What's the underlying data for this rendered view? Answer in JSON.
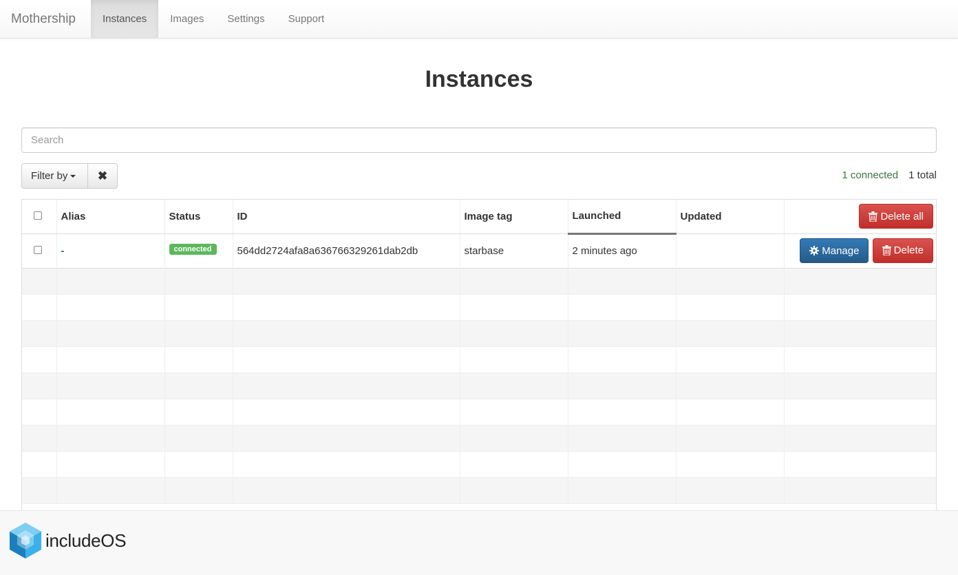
{
  "navbar": {
    "brand": "Mothership",
    "items": [
      {
        "label": "Instances",
        "active": true
      },
      {
        "label": "Images",
        "active": false
      },
      {
        "label": "Settings",
        "active": false
      },
      {
        "label": "Support",
        "active": false
      }
    ]
  },
  "page": {
    "title": "Instances"
  },
  "search": {
    "placeholder": "Search",
    "value": ""
  },
  "filter": {
    "label": "Filter by",
    "clear_icon": "✖"
  },
  "counts": {
    "connected": "1 connected",
    "total": "1 total"
  },
  "table": {
    "headers": {
      "alias": "Alias",
      "status": "Status",
      "id": "ID",
      "image_tag": "Image tag",
      "launched": "Launched",
      "updated": "Updated"
    },
    "sorted_column": "launched",
    "delete_all_label": "Delete all",
    "rows": [
      {
        "alias": "-",
        "status": "connected",
        "id": "564dd2724afa8a636766329261dab2db",
        "image_tag": "starbase",
        "launched": "2 minutes ago",
        "updated": "",
        "manage_label": "Manage",
        "delete_label": "Delete"
      }
    ]
  },
  "footer": {
    "logo_text_a": "include",
    "logo_text_b": "OS"
  },
  "colors": {
    "connected_green": "#5cb85c",
    "danger_red": "#d9534f",
    "primary_blue": "#337ab7",
    "logo_blue": "#29a3e0"
  }
}
